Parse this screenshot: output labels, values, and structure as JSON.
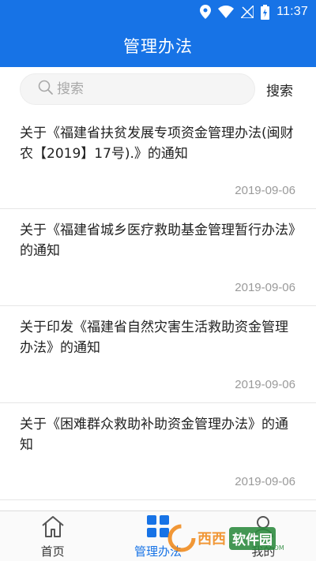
{
  "status_bar": {
    "time": "11:37",
    "icons": [
      "location-icon",
      "wifi-icon",
      "no-sim-icon",
      "battery-charging-icon"
    ]
  },
  "header": {
    "title": "管理办法"
  },
  "search": {
    "placeholder": "搜索",
    "button_label": "搜索"
  },
  "articles": [
    {
      "title": "关于《福建省扶贫发展专项资金管理办法(闽财农【2019】17号).》的通知",
      "date": "2019-09-06"
    },
    {
      "title": "关于《福建省城乡医疗救助基金管理暂行办法》的通知",
      "date": "2019-09-06"
    },
    {
      "title": "关于印发《福建省自然灾害生活救助资金管理办法》的通知",
      "date": "2019-09-06"
    },
    {
      "title": "关于《困难群众救助补助资金管理办法》的通知",
      "date": "2019-09-06"
    }
  ],
  "bottom_nav": {
    "items": [
      {
        "label": "首页",
        "icon": "home-icon",
        "active": false
      },
      {
        "label": "管理办法",
        "icon": "grid-icon",
        "active": true
      },
      {
        "label": "我的",
        "icon": "user-icon",
        "active": false
      }
    ]
  },
  "watermark": {
    "text": "西西",
    "sub": "软件园",
    "url": "CR173.COM"
  },
  "colors": {
    "primary": "#1773e6",
    "divider": "#e6e6e6",
    "date": "#9a9a9a"
  }
}
